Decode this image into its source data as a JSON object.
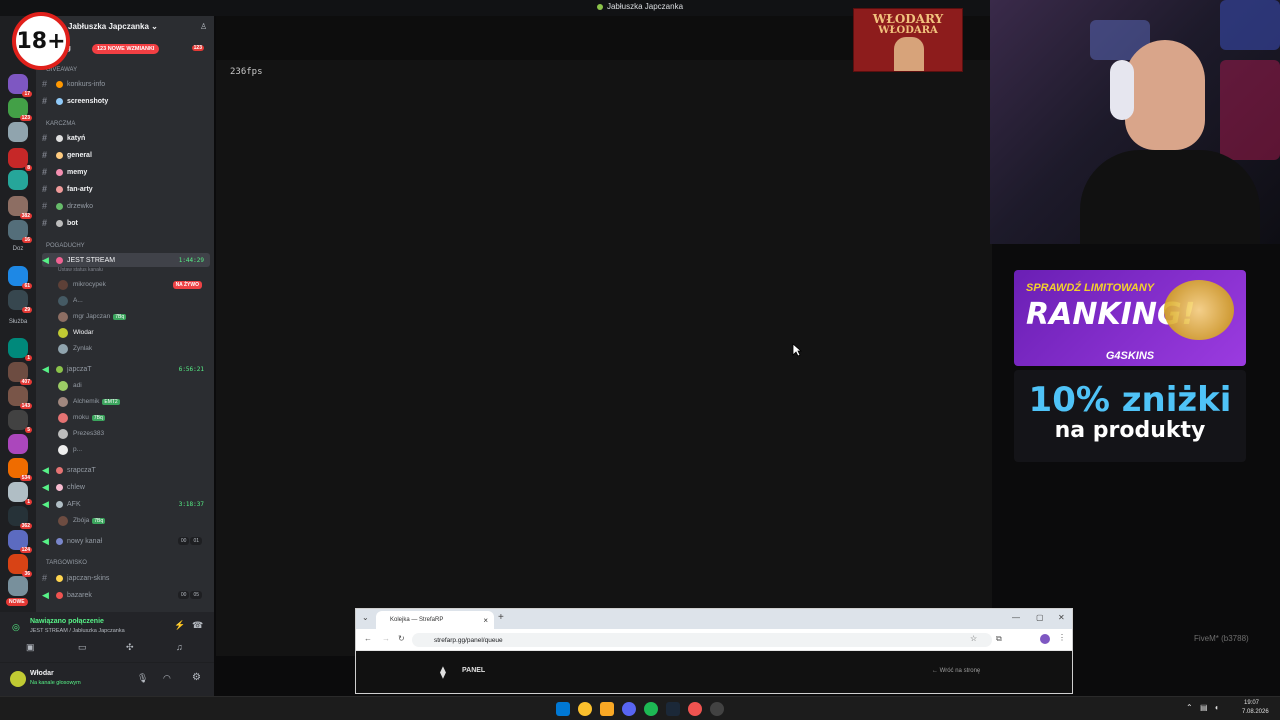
{
  "window": {
    "title": "Jabłuszka Japczanka"
  },
  "badge_18": "18+",
  "server_rail": {
    "labels": [
      "Doz",
      "Służba"
    ],
    "new_label": "NOWE",
    "badges": [
      "17",
      "123",
      "8",
      "2",
      "382",
      "16",
      "61",
      "29",
      "1",
      "407",
      "143",
      "5",
      "534",
      "1",
      "362",
      "124",
      "36"
    ]
  },
  "server": {
    "name": "Jabłuszka Japczanka",
    "mention_pill": "123 NOWE WZMIANKI",
    "first_channel": "ping",
    "first_channel_badge": "123",
    "categories": {
      "giveaway": "GIVEAWAY",
      "karczma": "KARCZMA",
      "pogaduchy": "POGADUCHY",
      "targowisko": "TARGOWISKO"
    },
    "text_channels": [
      {
        "name": "konkurs-info",
        "bright": false
      },
      {
        "name": "screenshoty",
        "bright": true
      },
      {
        "name": "katyń",
        "bright": true
      },
      {
        "name": "general",
        "bright": true
      },
      {
        "name": "memy",
        "bright": true
      },
      {
        "name": "fan-arty",
        "bright": true
      },
      {
        "name": "drzewko",
        "bright": false
      },
      {
        "name": "bot",
        "bright": true
      }
    ],
    "voice": {
      "jest_stream": {
        "name": "JEST STREAM",
        "time": "1:44:29",
        "status": "Ustaw status kanału",
        "live": "NA ŻYWO"
      },
      "jest_stream_users": [
        "mikrocypek",
        "A...",
        "mgr Japczan",
        "Włodar",
        "Zynlak"
      ],
      "japczat": {
        "name": "japczaT",
        "time": "6:56:21"
      },
      "japczat_users": [
        "adi",
        "Alchemik",
        "moku",
        "Prezes383",
        "p..."
      ],
      "srapczat": "srapczaT",
      "chlew": "chlew",
      "afk": {
        "name": "AFK",
        "time": "3:18:37"
      },
      "afk_users": [
        "Zbója"
      ],
      "nowy_kanal": {
        "name": "nowy kanał",
        "count_a": "00",
        "count_b": "01"
      },
      "targ_channels": [
        "japczan-skins",
        "bazarek"
      ],
      "bazarek_counts": [
        "00",
        "05"
      ]
    },
    "tags": {
      "mgr": "7Bq",
      "alchemik": "EMT2",
      "moku": "7Bq",
      "zboja": "7Bq"
    }
  },
  "voice_panel": {
    "status": "Nawiązano połączenie",
    "location": "JEST STREAM / Jabłuszka Japczanka"
  },
  "user_panel": {
    "name": "Włodar",
    "status": "Na kanale głosowym"
  },
  "game": {
    "fps": "236fps",
    "overlay_text": "FiveM* (b3788)"
  },
  "banner": {
    "line1": "WŁODARY",
    "line2": "WŁODARA"
  },
  "ad": {
    "line1": "SPRAWDŹ LIMITOWANY",
    "line2": "RANKING!",
    "brand": "G4SKINS",
    "promo1": "10% zniżki",
    "promo2": "na produkty"
  },
  "browser": {
    "tab_title": "Kolejka — StrefaRP",
    "url": "strefarp.gg/panel/queue",
    "panel_label": "PANEL",
    "back_link": "← Wróć na stronę"
  },
  "taskbar": {
    "time": "19:07",
    "date": "7.08.2026"
  },
  "colors": {
    "discord_bg": "#2b2d31",
    "accent_green": "#57f287",
    "live_red": "#ed4245",
    "ad_purple": "#9b3be0",
    "promo_blue": "#4fc3f7"
  }
}
